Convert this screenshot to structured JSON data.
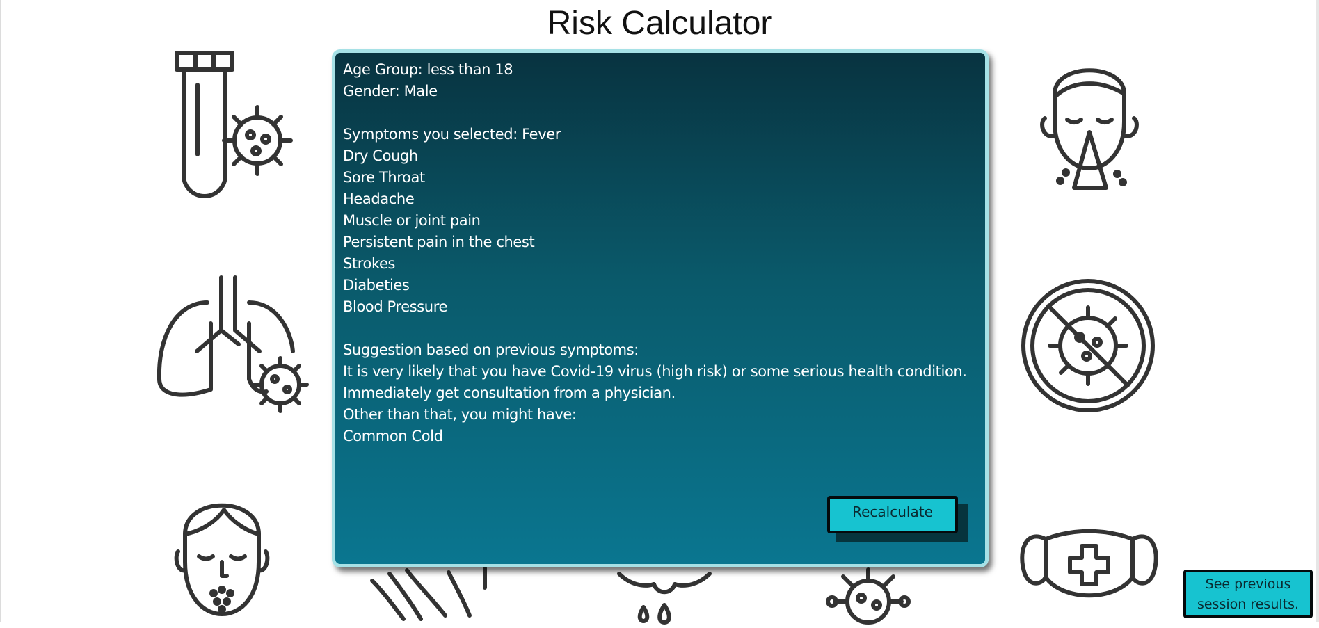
{
  "page": {
    "title": "Risk Calculator"
  },
  "result": {
    "text": "Age Group: less than 18\nGender: Male\n\nSymptoms you selected: Fever\nDry Cough\nSore Throat\nHeadache\nMuscle or joint pain\nPersistent pain in the chest\nStrokes\nDiabeties\nBlood Pressure\n\nSuggestion based on previous symptoms:\nIt is very likely that you have Covid-19 virus (high risk) or some serious health condition.\nImmediately get consultation from a physician.\nOther than that, you might have:\nCommon Cold"
  },
  "buttons": {
    "recalculate": "Recalculate",
    "previous_results": "See previous session results."
  },
  "icons": [
    "test-tube-virus-icon",
    "sneezing-person-icon",
    "lungs-virus-icon",
    "no-virus-icon",
    "rash-face-icon",
    "face-mask-icon",
    "hand-icon",
    "drops-icon",
    "virus-icon"
  ],
  "colors": {
    "card_top": "#083340",
    "card_bottom": "#0a7690",
    "card_border": "#a6e1e6",
    "button": "#17c3d0",
    "icon_stroke": "#333333"
  }
}
